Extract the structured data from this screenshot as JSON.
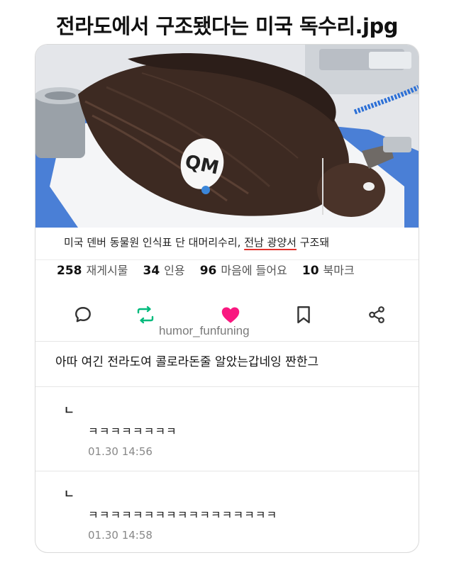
{
  "post": {
    "title": "전라도에서 구조됐다는 미국 독수리.jpg"
  },
  "photo": {
    "tag_text": "QM"
  },
  "caption": {
    "text_before": "미국 덴버 동물원 인식표 단 대머리수리, ",
    "text_highlight": "전남 광양서",
    "text_after": " 구조돼"
  },
  "stats": {
    "reposts_count": "258",
    "reposts_label": "재게시물",
    "quotes_count": "34",
    "quotes_label": "인용",
    "likes_count": "96",
    "likes_label": "마음에 들어요",
    "bookmarks_count": "10",
    "bookmarks_label": "북마크"
  },
  "icons": {
    "reply": "speech-bubble-icon",
    "repost": "repost-arrows-icon",
    "like": "heart-icon",
    "bookmark": "bookmark-icon",
    "share": "share-icon",
    "repost_color": "#00ba7c",
    "like_color": "#f91880"
  },
  "watermark": "humor_funfuning",
  "comment": {
    "text": "아따 여긴 전라도여 콜로라돈줄 알았는갑네잉 짠한그"
  },
  "replies": [
    {
      "mark": "ㄴ",
      "text": "ㅋㅋㅋㅋㅋㅋㅋㅋ",
      "time": "01.30 14:56"
    },
    {
      "mark": "ㄴ",
      "text": "ㅋㅋㅋㅋㅋㅋㅋㅋㅋㅋㅋㅋㅋㅋㅋㅋㅋ",
      "time": "01.30 14:58"
    }
  ]
}
